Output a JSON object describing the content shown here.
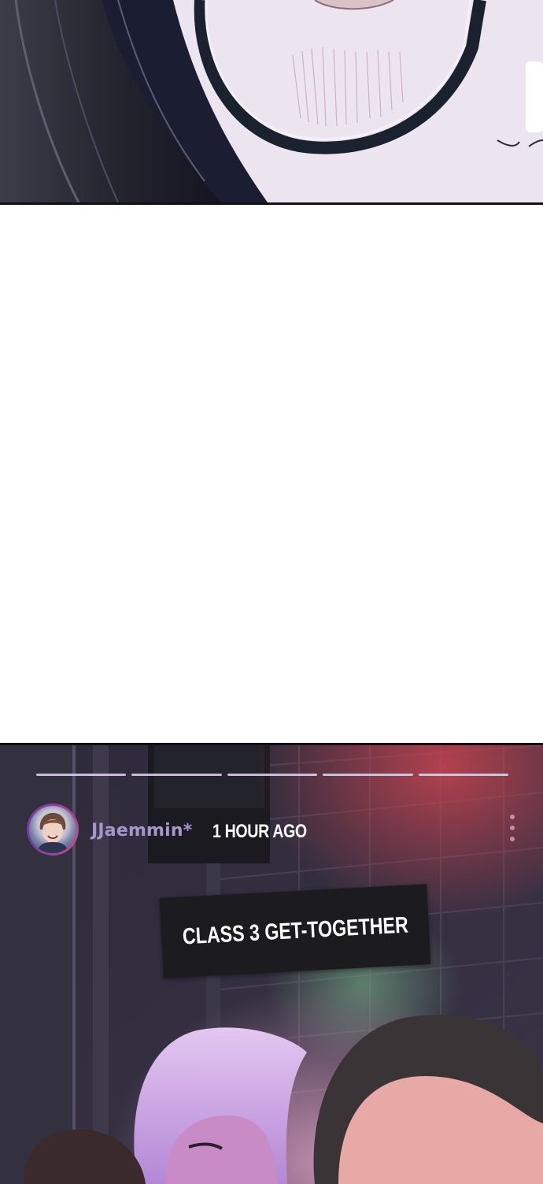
{
  "story": {
    "progress_segments": 5,
    "username": "JJaemmin*",
    "timestamp": "1 HOUR AGO",
    "caption": "CLASS 3 GET-TOGETHER"
  },
  "icons": {
    "more": "vertical-ellipsis-icon",
    "avatar": "profile-avatar"
  },
  "colors": {
    "username": "#a796c9",
    "progress": "#e1d7f0",
    "caption_bg": "#1c1c20",
    "more_dots": "#c98ea6"
  }
}
